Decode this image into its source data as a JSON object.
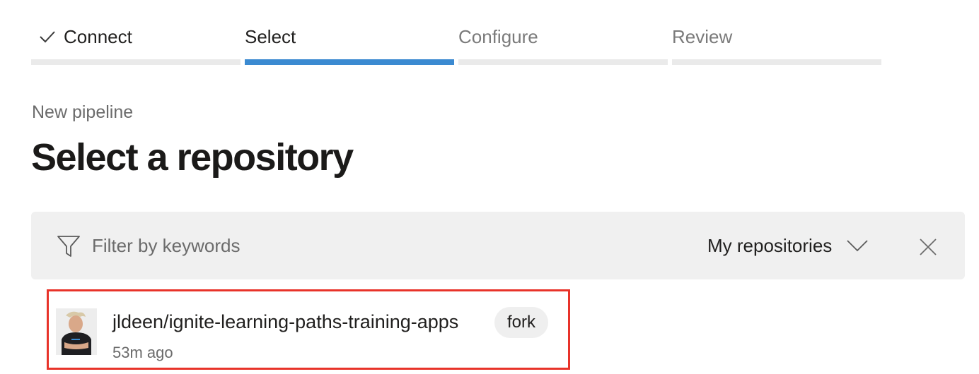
{
  "wizard": {
    "steps": [
      {
        "label": "Connect",
        "state": "done"
      },
      {
        "label": "Select",
        "state": "active"
      },
      {
        "label": "Configure",
        "state": "future"
      },
      {
        "label": "Review",
        "state": "future"
      }
    ]
  },
  "breadcrumb": "New pipeline",
  "page_title": "Select a repository",
  "filter": {
    "placeholder": "Filter by keywords",
    "value": "",
    "scope_selected": "My repositories"
  },
  "repositories": [
    {
      "name": "jldeen/ignite-learning-paths-training-apps",
      "badge": "fork",
      "time": "53m ago"
    }
  ],
  "colors": {
    "accent": "#3b8ad1",
    "highlight_border": "#e8332a",
    "filter_bg": "#f0f0f0"
  },
  "icons": {
    "step_done": "checkmark-icon",
    "filter": "filter-icon",
    "dropdown": "chevron-down-icon",
    "close": "close-icon"
  }
}
